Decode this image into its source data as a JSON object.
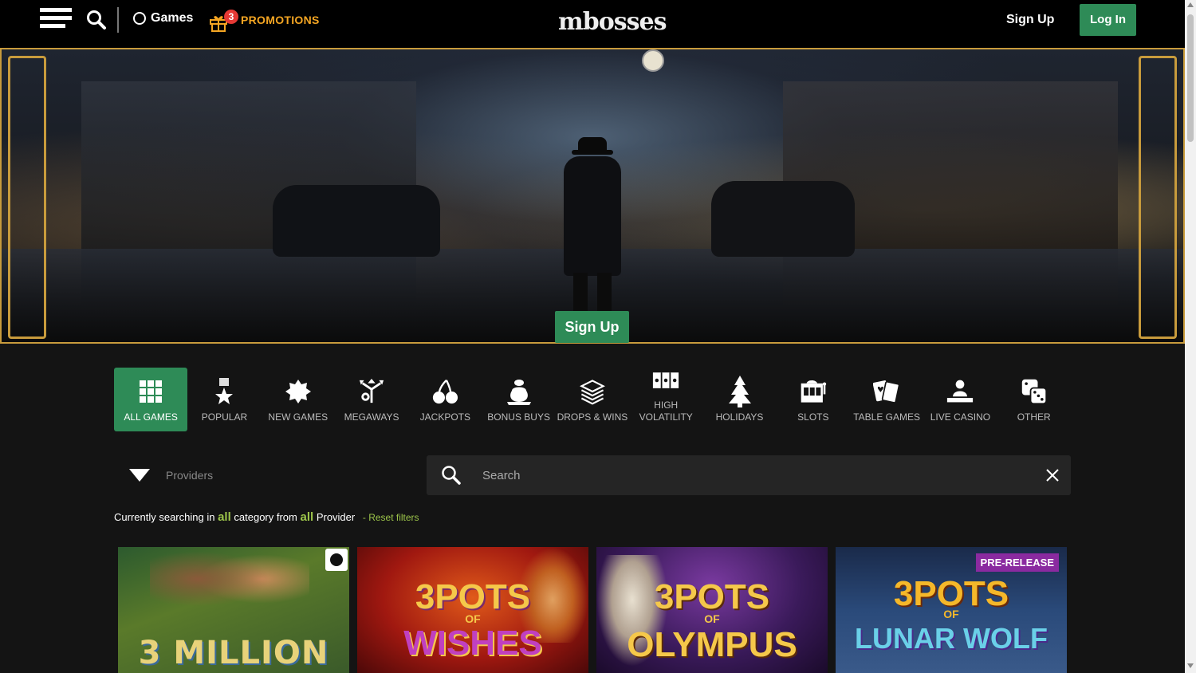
{
  "header": {
    "games_label": "Games",
    "promo_count": "3",
    "promo_label": "PROMOTIONS",
    "logo_text": "mbosses",
    "signup_label": "Sign Up",
    "login_label": "Log In"
  },
  "hero": {
    "signup_label": "Sign Up"
  },
  "categories": [
    {
      "label": "ALL GAMES",
      "icon": "grid-icon",
      "active": true
    },
    {
      "label": "POPULAR",
      "icon": "medal-icon"
    },
    {
      "label": "NEW GAMES",
      "icon": "new-badge-icon"
    },
    {
      "label": "MEGAWAYS",
      "icon": "megaways-icon"
    },
    {
      "label": "JACKPOTS",
      "icon": "cherries-icon"
    },
    {
      "label": "BONUS BUYS",
      "icon": "money-bag-icon"
    },
    {
      "label": "DROPS & WINS",
      "icon": "cash-stack-icon"
    },
    {
      "label": "HIGH VOLATILITY",
      "icon": "slot-stars-icon"
    },
    {
      "label": "HOLIDAYS",
      "icon": "christmas-tree-icon"
    },
    {
      "label": "SLOTS",
      "icon": "slot-machine-icon"
    },
    {
      "label": "TABLE GAMES",
      "icon": "cards-icon"
    },
    {
      "label": "LIVE CASINO",
      "icon": "dealer-icon"
    },
    {
      "label": "OTHER",
      "icon": "dice-icon"
    }
  ],
  "filters": {
    "providers_label": "Providers",
    "search_placeholder": "Search"
  },
  "status": {
    "prefix": "Currently searching in",
    "category": "all",
    "mid": "category from",
    "provider": "all",
    "suffix": "Provider",
    "reset": "- Reset filters"
  },
  "games": [
    {
      "title_line1": "3 MILLION",
      "title_line2": "",
      "badge": "new"
    },
    {
      "title_line1": "3POTS",
      "title_line2": "WISHES",
      "of": "OF"
    },
    {
      "title_line1": "3POTS",
      "title_line2": "OLYMPUS",
      "of": "OF"
    },
    {
      "title_line1": "3POTS",
      "title_line2": "LUNAR WOLF",
      "of": "OF",
      "tag": "PRE-RELEASE"
    }
  ],
  "colors": {
    "accent_green": "#2e8b57",
    "promo_orange": "#f5a623",
    "gold_frame": "#c89b3c",
    "filter_highlight": "#9cc44a"
  }
}
